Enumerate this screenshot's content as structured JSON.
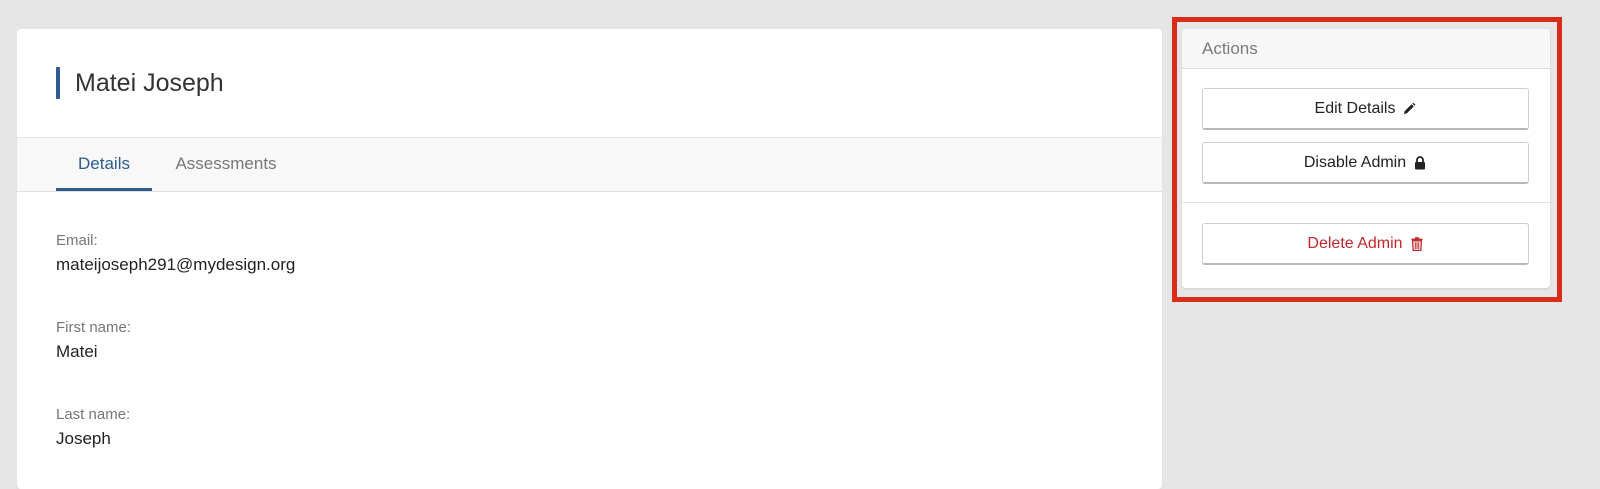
{
  "profile": {
    "title": "Matei Joseph",
    "tabs": [
      {
        "label": "Details",
        "active": true
      },
      {
        "label": "Assessments",
        "active": false
      }
    ],
    "fields": [
      {
        "label": "Email:",
        "value": "mateijoseph291@mydesign.org"
      },
      {
        "label": "First name:",
        "value": "Matei"
      },
      {
        "label": "Last name:",
        "value": "Joseph"
      }
    ]
  },
  "actions": {
    "header": "Actions",
    "edit": {
      "label": "Edit Details",
      "icon": "pencil-icon"
    },
    "disable": {
      "label": "Disable Admin",
      "icon": "lock-icon"
    },
    "delete": {
      "label": "Delete Admin",
      "icon": "trash-icon"
    }
  },
  "colors": {
    "accent": "#2d5a8f",
    "danger": "#c0282d",
    "highlight": "#d92d1a",
    "background": "#e6e6e6"
  }
}
